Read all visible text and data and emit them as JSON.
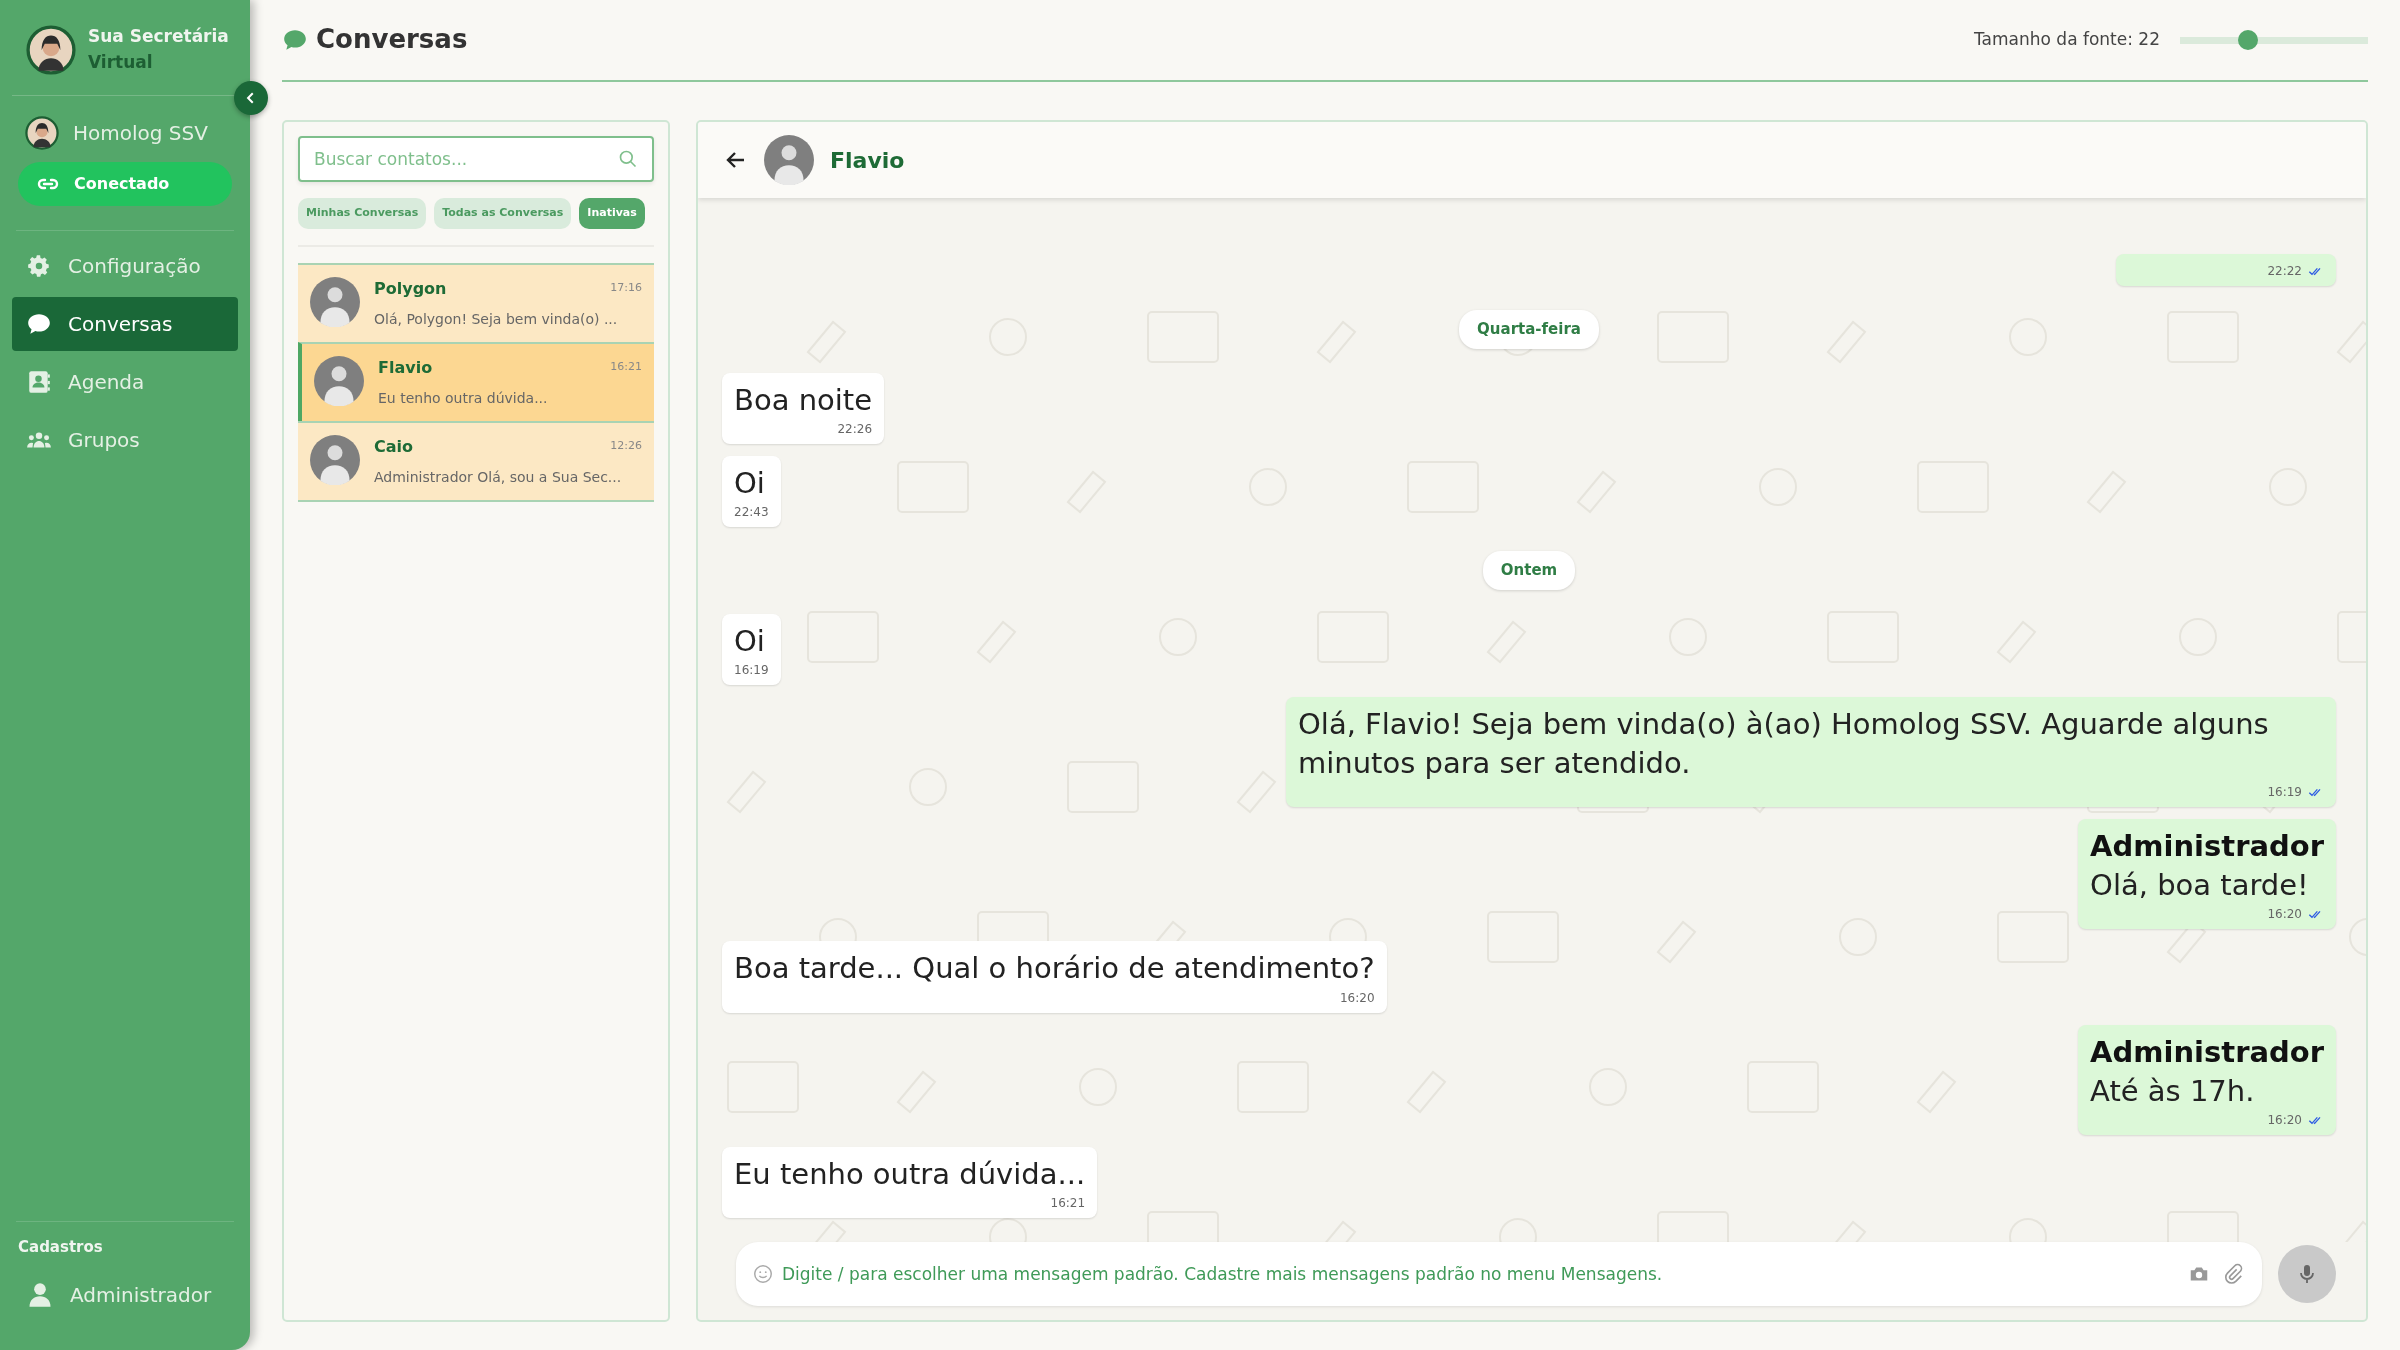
{
  "sidebar": {
    "brand": {
      "line1": "Sua Secretária",
      "line2": "Virtual"
    },
    "account": {
      "name": "Homolog SSV"
    },
    "connection": {
      "label": "Conectado",
      "connected": true
    },
    "items": [
      {
        "label": "Configuração",
        "selected": false
      },
      {
        "label": "Conversas",
        "selected": true
      },
      {
        "label": "Agenda",
        "selected": false
      },
      {
        "label": "Grupos",
        "selected": false
      }
    ],
    "section": "Cadastros",
    "footer_items": [
      {
        "label": "Administrador",
        "selected": false
      }
    ]
  },
  "header": {
    "title": "Conversas",
    "font_size_label": "Tamanho da fonte: 22",
    "font_size": {
      "level": 0.36
    }
  },
  "contacts": {
    "search": {
      "placeholder": "Buscar contatos..."
    },
    "filters": [
      {
        "label": "Minhas Conversas",
        "selected": false
      },
      {
        "label": "Todas as Conversas",
        "selected": false
      },
      {
        "label": "Inativas",
        "selected": true
      }
    ],
    "items": [
      {
        "name": "Polygon",
        "time": "17:16",
        "preview": "Olá, Polygon! Seja bem vinda(o) ...",
        "selected": false
      },
      {
        "name": "Flavio",
        "time": "16:21",
        "preview": "Eu tenho outra dúvida...",
        "selected": true
      },
      {
        "name": "Caio",
        "time": "12:26",
        "preview": "Administrador Olá, sou a Sua Sec...",
        "selected": false
      }
    ]
  },
  "chat": {
    "contact": "Flavio",
    "messages": [
      {
        "kind": "sent",
        "time": "22:22"
      },
      {
        "kind": "date",
        "text": "Quarta-feira"
      },
      {
        "kind": "received",
        "text": "Boa noite",
        "time": "22:26"
      },
      {
        "kind": "received",
        "text": "Oi",
        "time": "22:43"
      },
      {
        "kind": "date",
        "text": "Ontem"
      },
      {
        "kind": "received",
        "text": "Oi",
        "time": "16:19"
      },
      {
        "kind": "sent",
        "text": "Olá, Flavio! Seja bem vinda(o) à(ao) Homolog SSV. Aguarde alguns minutos para ser atendido.",
        "time": "16:19"
      },
      {
        "kind": "sent",
        "author": "Administrador",
        "text": "Olá, boa tarde!",
        "time": "16:20"
      },
      {
        "kind": "received",
        "text": "Boa tarde... Qual o horário de atendimento?",
        "time": "16:20"
      },
      {
        "kind": "sent",
        "author": "Administrador",
        "text": "Até às 17h.",
        "time": "16:20"
      },
      {
        "kind": "received",
        "text": "Eu tenho outra dúvida...",
        "time": "16:21"
      }
    ],
    "composer": {
      "placeholder": "Digite / para escolher uma mensagem padrão. Cadastre mais mensagens padrão no menu Mensagens."
    }
  }
}
